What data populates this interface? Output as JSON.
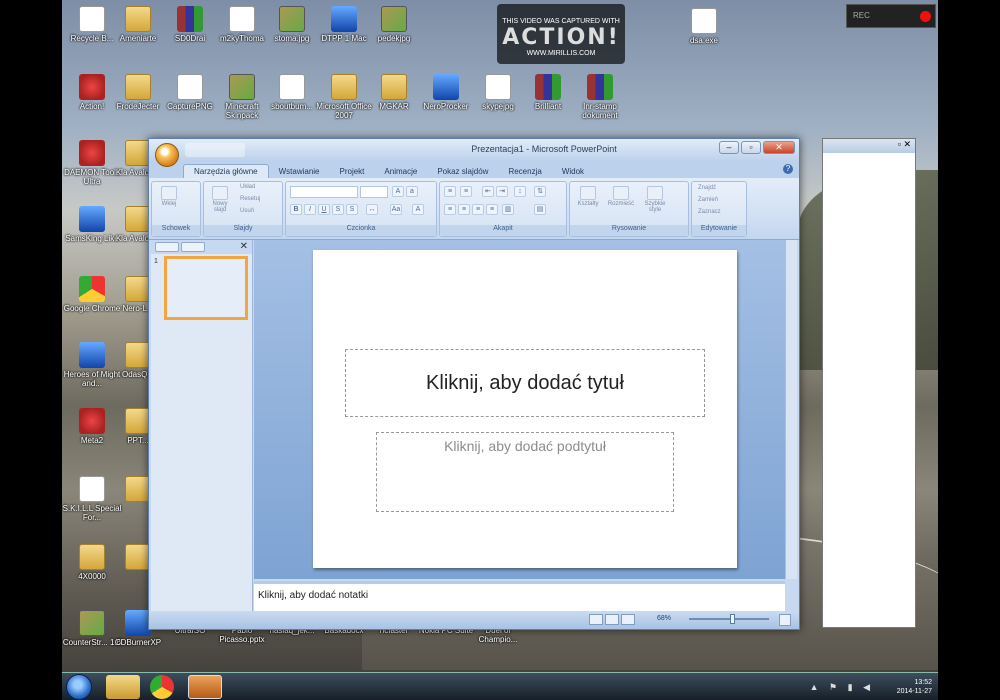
{
  "desktop": {
    "icons_row1": [
      "Recycle B...",
      "Ameniarte",
      "SD0Drai",
      "m2kyThoma",
      "stoma.jpg",
      "DTPP 1 Mac",
      "pedekjpg",
      "",
      "",
      "dsa.exe"
    ],
    "icons_row2": [
      "Action!",
      "FrodeJecter",
      "CapturePNG",
      "Minecraft Skinpack",
      "sboutbum...",
      "Microsoft Office 2007",
      "MGKAR",
      "NeroProcker",
      "skypejpg",
      "Brilliant",
      "Inr-stamp dokument"
    ],
    "icons_left": [
      "DAEMON Tools Ultra",
      "SamsKing Like",
      "Google Chrome",
      "Heroes of Might and...",
      "Meta2",
      "S.K.I.L.L Special For...",
      "4X0000",
      "CounterStr... 1.6"
    ],
    "icons_col2": [
      "Kla Avalon...",
      "Kla Avalon...",
      "Nero-L...",
      "OdasQ...",
      "PPT...",
      "",
      "",
      ""
    ],
    "icons_bottom": [
      "CDBurnerXP",
      "UltraISO",
      "Pablo Picasso.pptx",
      "haslaq_jek...",
      "Baskadocx",
      "hcfaster",
      "Nokia PC Suite",
      "Duel of Champio..."
    ]
  },
  "watermark": {
    "line1": "THIS VIDEO WAS CAPTURED WITH",
    "logo": "ACTION!",
    "line3": "WWW.MIRILLIS.COM"
  },
  "powerpoint": {
    "title": "Prezentacja1 - Microsoft PowerPoint",
    "tabs": [
      "Narzędzia główne",
      "Wstawianie",
      "Projekt",
      "Animacje",
      "Pokaz slajdów",
      "Recenzja",
      "Widok"
    ],
    "groups": {
      "clipboard": "Schowek",
      "slides": "Slajdy",
      "font": "Czcionka",
      "paragraph": "Akapit",
      "drawing": "Rysowanie",
      "editing": "Edytowanie"
    },
    "ribbon_buttons": {
      "paste": "Wklej",
      "new_slide": "Nowy slajd",
      "layout": "Układ",
      "reset": "Resetuj",
      "delete": "Usuń",
      "shapes": "Kształty",
      "arrange": "Rozmieść",
      "quick_styles": "Szybkie style",
      "find": "Znajdź",
      "replace": "Zamień",
      "select": "Zaznacz"
    },
    "slide_number": "1",
    "title_placeholder": "Kliknij, aby dodać tytuł",
    "subtitle_placeholder": "Kliknij, aby dodać podtytuł",
    "notes_placeholder": "Kliknij, aby dodać notatki",
    "zoom": "68%"
  },
  "taskbar": {
    "time": "13:52",
    "date": "2014-11-27"
  }
}
